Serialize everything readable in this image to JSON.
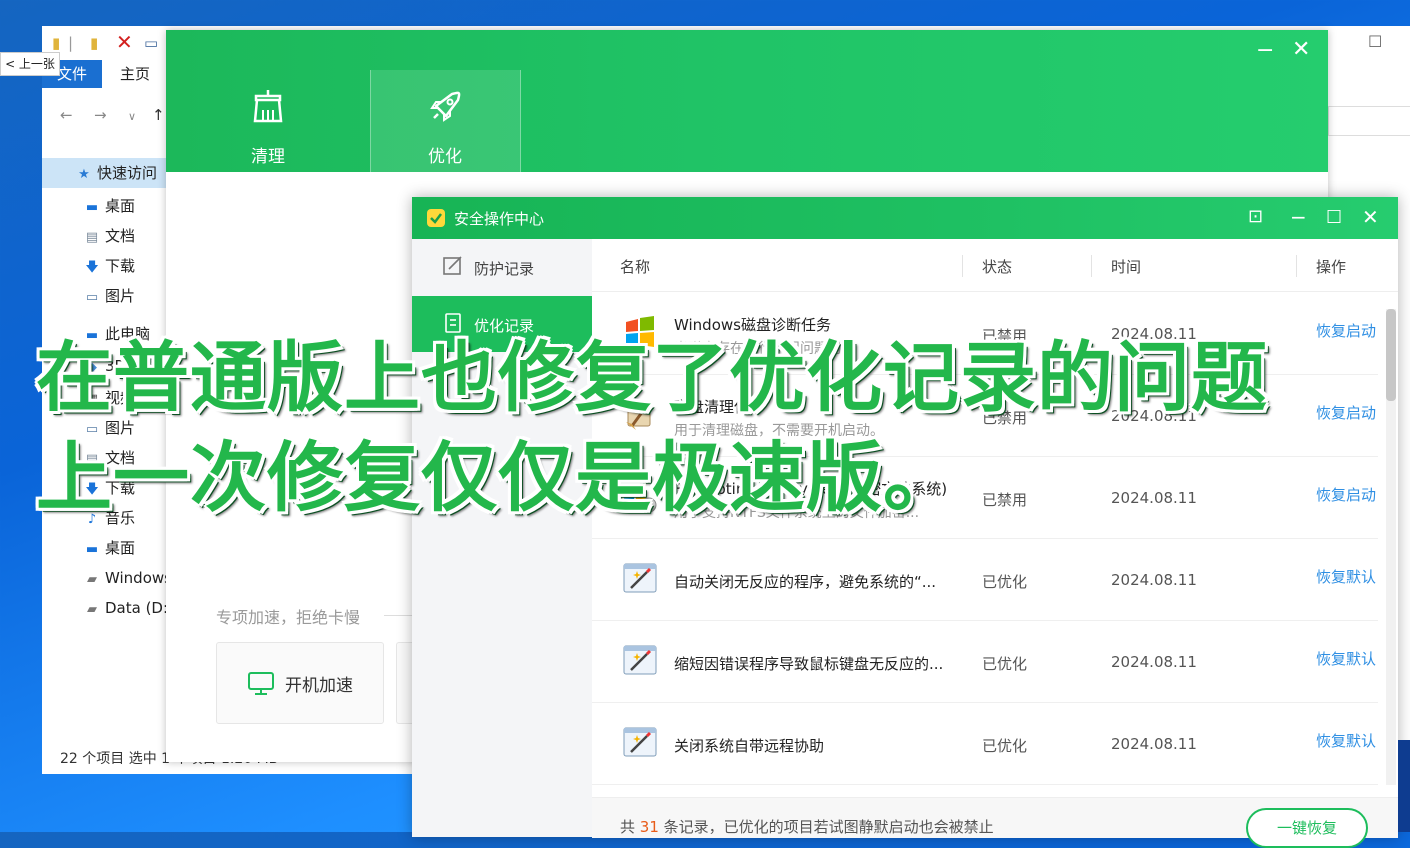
{
  "explorer": {
    "prev_button": "< 上一张",
    "tabs": {
      "file": "文件",
      "home": "主页"
    },
    "nav": {
      "quick_access": "快速访问",
      "items": [
        "桌面",
        "文档",
        "下载",
        "图片",
        "此电脑",
        "3D 对象",
        "视频",
        "图片",
        "文档",
        "下载",
        "音乐",
        "桌面",
        "Windows",
        "Data (D:)"
      ]
    },
    "status": "22 个项目    选中 1 个项目  1.20 MB"
  },
  "main_window": {
    "tabs": [
      {
        "label": "清理"
      },
      {
        "label": "优化"
      }
    ],
    "accel_caption": "专项加速，拒绝卡慢",
    "accel_card": "开机加速"
  },
  "dialog": {
    "title": "安全操作中心",
    "sidebar": [
      {
        "label": "防护记录"
      },
      {
        "label": "优化记录"
      }
    ],
    "columns": {
      "name": "名称",
      "status": "状态",
      "time": "时间",
      "action": "操作"
    },
    "rows": [
      {
        "name": "Windows磁盘诊断任务",
        "desc": "当磁盘存在运行状况问题时...",
        "status": "已禁用",
        "time": "2024.08.11",
        "action": "恢复启动",
        "icon": "windows-task-icon"
      },
      {
        "name": "磁盘清理任务",
        "desc": "用于清理磁盘，不需要开机启动。",
        "status": "已禁用",
        "time": "2024.08.11",
        "action": "恢复启动",
        "icon": "broom-task-icon"
      },
      {
        "name": "Encrypting File System(加密文件系统)",
        "desc": "用于支持NTFS文件系统上的文件加密...",
        "status": "已禁用",
        "time": "2024.08.11",
        "action": "恢复启动",
        "icon": "windows-gear-icon"
      },
      {
        "name": "自动关闭无反应的程序，避免系统的“...",
        "desc": "",
        "status": "已优化",
        "time": "2024.08.11",
        "action": "恢复默认",
        "icon": "magic-wand-window-icon"
      },
      {
        "name": "缩短因错误程序导致鼠标键盘无反应的...",
        "desc": "",
        "status": "已优化",
        "time": "2024.08.11",
        "action": "恢复默认",
        "icon": "magic-wand-window-icon"
      },
      {
        "name": "关闭系统自带远程协助",
        "desc": "",
        "status": "已优化",
        "time": "2024.08.11",
        "action": "恢复默认",
        "icon": "magic-wand-window-icon"
      }
    ],
    "footer": {
      "prefix": "共 ",
      "count": "31",
      "suffix": " 条记录，已优化的项目若试图静默启动也会被禁止",
      "restore_all": "一键恢复"
    }
  },
  "caption": {
    "line1": "在普通版上也修复了优化记录的问题",
    "line2": "上一次修复仅仅是极速版。"
  },
  "colors": {
    "accent": "#1dbd5c",
    "link": "#2f8fe3",
    "caption": "#23b74b",
    "count": "#e85c19"
  }
}
